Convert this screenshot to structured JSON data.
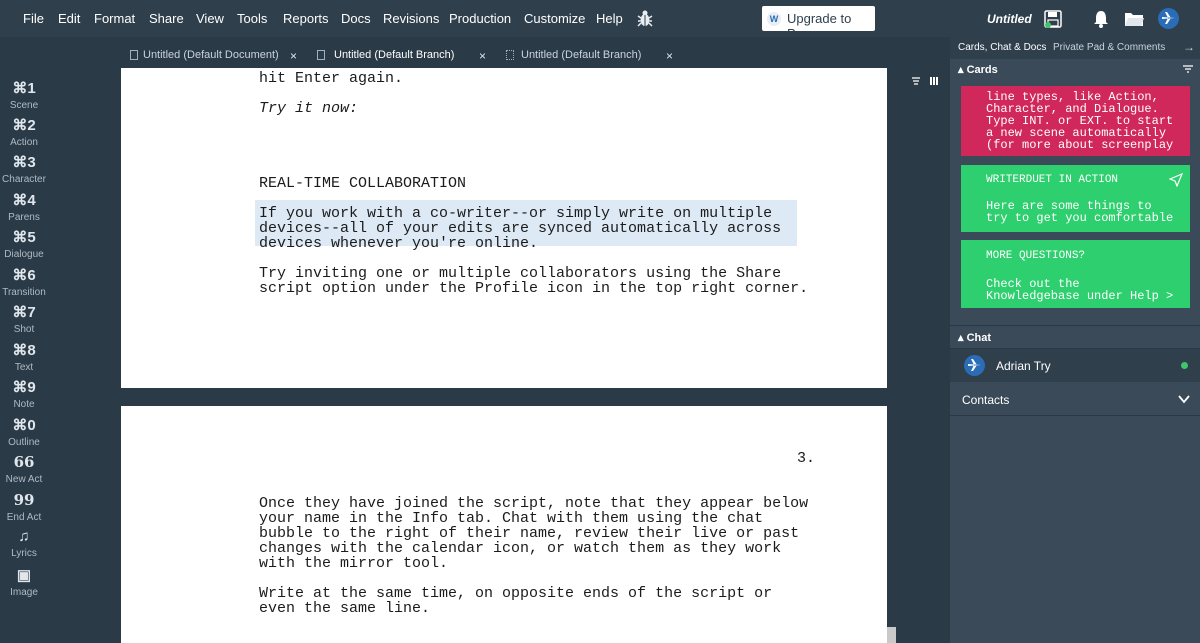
{
  "menu": [
    "File",
    "Edit",
    "Format",
    "Share",
    "View",
    "Tools",
    "Reports",
    "Docs",
    "Revisions",
    "Production",
    "Customize",
    "Help"
  ],
  "upgrade_label": "Upgrade to Pro",
  "doc_title": "Untitled",
  "tabs": [
    {
      "label": "Untitled (Default Document)",
      "close": "×"
    },
    {
      "label": "Untitled (Default Branch)",
      "close": "×"
    },
    {
      "label": "Untitled (Default Branch)",
      "close": "×"
    }
  ],
  "left_tools": [
    {
      "key": "⌘1",
      "label": "Scene"
    },
    {
      "key": "⌘2",
      "label": "Action"
    },
    {
      "key": "⌘3",
      "label": "Character"
    },
    {
      "key": "⌘4",
      "label": "Parens"
    },
    {
      "key": "⌘5",
      "label": "Dialogue"
    },
    {
      "key": "⌘6",
      "label": "Transition"
    },
    {
      "key": "⌘7",
      "label": "Shot"
    },
    {
      "key": "⌘8",
      "label": "Text"
    },
    {
      "key": "⌘9",
      "label": "Note"
    },
    {
      "key": "⌘0",
      "label": "Outline"
    },
    {
      "key": "66",
      "label": "New Act"
    },
    {
      "key": "99",
      "label": "End Act"
    },
    {
      "key": "♫",
      "label": "Lyrics"
    },
    {
      "key": "▣",
      "label": "Image"
    }
  ],
  "page1": {
    "line_top": "hit Enter again.",
    "try_now": "Try it now:",
    "heading": "REAL-TIME COLLABORATION",
    "highlighted": [
      "If you work with a co-writer--or simply write on multiple",
      "devices--all of your edits are synced automatically across",
      "devices whenever you're online."
    ],
    "invite": [
      "Try inviting one or multiple collaborators using the Share",
      "script option under the Profile icon in the top right corner."
    ]
  },
  "page2": {
    "page_number": "3.",
    "para1": [
      "Once they have joined the script, note that they appear below",
      "your name in the Info tab. Chat with them using the chat",
      "bubble to the right of their name, review their live or past",
      "changes with the calendar icon, or watch them as they work",
      "with the mirror tool."
    ],
    "para2": [
      "Write at the same time, on opposite ends of the script or",
      "even the same line."
    ]
  },
  "right_panel": {
    "tabs": [
      "Cards, Chat & Docs",
      "Private Pad & Comments"
    ],
    "cards_header": "Cards",
    "cards": [
      {
        "color": "#d0285a",
        "lines": [
          "line types, like Action,",
          "Character, and Dialogue.",
          "Type INT. or EXT. to start",
          "a new scene automatically",
          "(for more about screenplay"
        ]
      },
      {
        "color": "#2ecf6e",
        "title": "WRITERDUET IN ACTION",
        "lines": [
          "Here are some things to",
          "try to get you comfortable"
        ]
      },
      {
        "color": "#2ecf6e",
        "title": "MORE QUESTIONS?",
        "lines": [
          "Check out the",
          "Knowledgebase under Help >"
        ]
      }
    ],
    "chat_header": "Chat",
    "chat_user": "Adrian Try",
    "contacts": "Contacts"
  },
  "colors": {
    "accent": "#2a6db6",
    "online": "#3fc56b"
  }
}
